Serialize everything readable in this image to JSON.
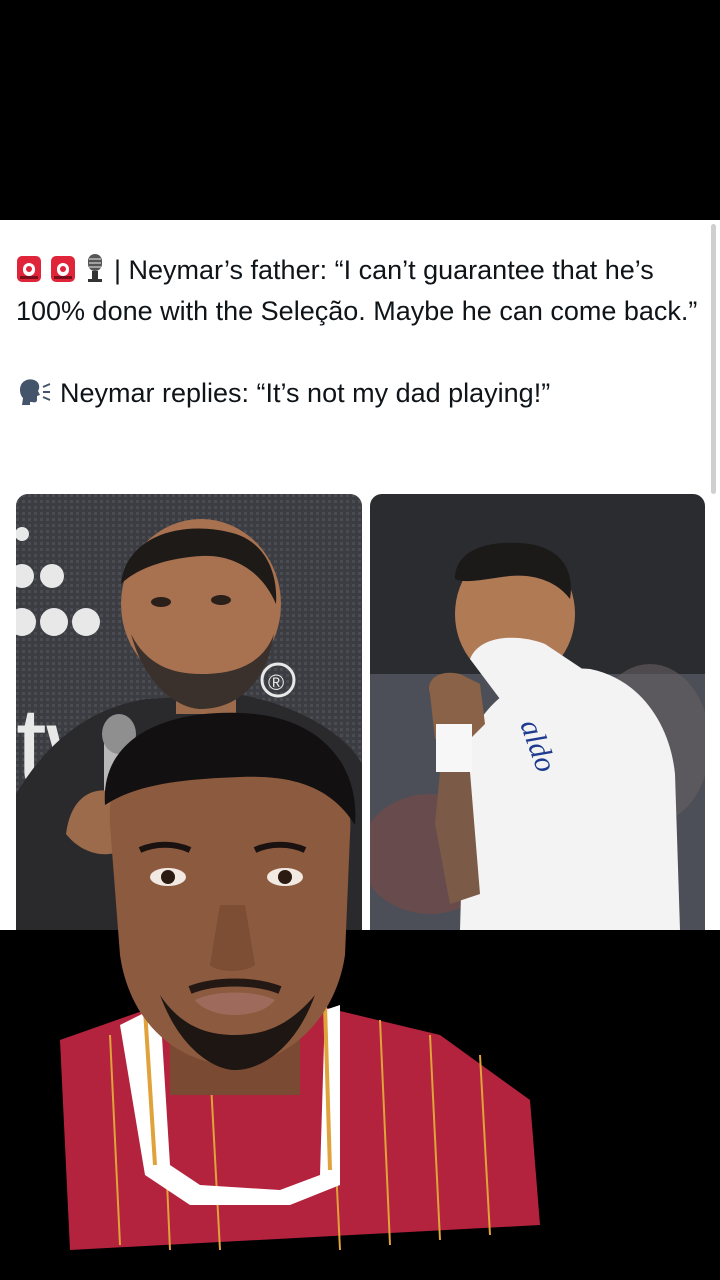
{
  "tweet": {
    "headline_emojis": [
      "siren-icon",
      "siren-icon",
      "microphone-icon"
    ],
    "line1": "| Neymar’s father: “I can’t guarantee that he’s 100% done with the Seleção. Maybe he can come back.”",
    "reply_emoji": "speaking-head-icon",
    "line2": "Neymar replies: “It’s not my dad playing!”"
  },
  "photos": {
    "left_backdrop_text": "tw",
    "left_backdrop_mark": "®",
    "right_shirt_text": "aldo"
  },
  "colors": {
    "tweet_background": "#ffffff",
    "text": "#0f1419",
    "siren_red": "#e0243a",
    "jersey_red": "#b3233d",
    "jersey_stripe": "#e0a23a"
  }
}
